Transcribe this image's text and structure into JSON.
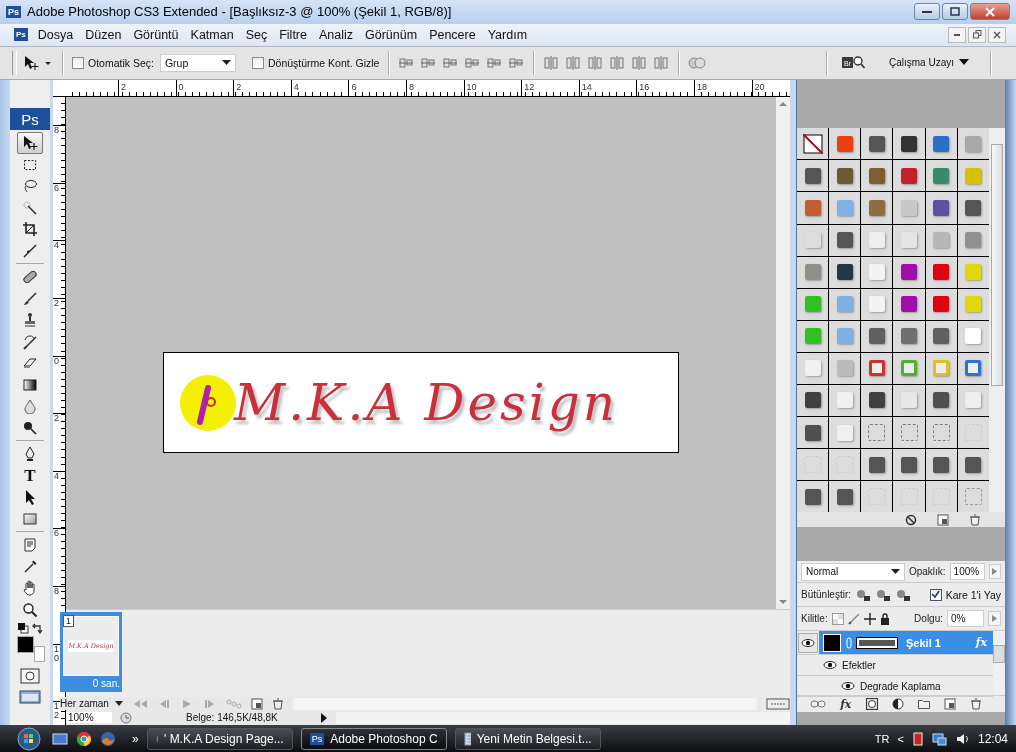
{
  "window": {
    "badge": "Ps",
    "title": "Adobe Photoshop CS3 Extended - [Başlıksız-3 @ 100% (Şekil 1, RGB/8)]"
  },
  "menu": {
    "badge": "Ps",
    "items": [
      "Dosya",
      "Düzen",
      "Görüntü",
      "Katman",
      "Seç",
      "Filtre",
      "Analiz",
      "Görünüm",
      "Pencere",
      "Yardım"
    ]
  },
  "options_bar": {
    "auto_select": {
      "label": "Otomatik Seç:",
      "checked": false
    },
    "auto_select_mode": "Grup",
    "transform_controls": {
      "label": "Dönüştürme Kont. Gizle",
      "checked": false
    },
    "bridge_badge": "Br",
    "workspace": "Çalışma Uzayı"
  },
  "toolbox": {
    "badge": "Ps",
    "tools": [
      {
        "kind": "move",
        "selected": true
      },
      {
        "kind": "marquee",
        "selected": false
      },
      {
        "kind": "lasso",
        "selected": false
      },
      {
        "kind": "wand",
        "selected": false
      },
      {
        "kind": "crop",
        "selected": false
      },
      {
        "kind": "slice",
        "selected": false
      },
      {
        "kind": "healing",
        "selected": false
      },
      {
        "kind": "brush",
        "selected": false
      },
      {
        "kind": "stamp",
        "selected": false
      },
      {
        "kind": "history",
        "selected": false
      },
      {
        "kind": "eraser",
        "selected": false
      },
      {
        "kind": "gradient",
        "selected": false
      },
      {
        "kind": "blur",
        "selected": false
      },
      {
        "kind": "dodge",
        "selected": false
      },
      {
        "kind": "pen",
        "selected": false
      },
      {
        "kind": "type",
        "label": "T",
        "selected": false
      },
      {
        "kind": "path",
        "selected": false
      },
      {
        "kind": "shape",
        "selected": false
      },
      {
        "kind": "notes",
        "selected": false
      },
      {
        "kind": "eyedropper",
        "selected": false
      },
      {
        "kind": "hand",
        "selected": false
      },
      {
        "kind": "zoom",
        "selected": false
      }
    ]
  },
  "rulers": {
    "horizontal": [
      "2",
      "0",
      "2",
      "4",
      "6",
      "8",
      "10",
      "12",
      "14",
      "16",
      "18",
      "20"
    ],
    "vertical": [
      "8",
      "6",
      "4",
      "2",
      "0",
      "2",
      "4",
      "6",
      "8",
      "10",
      "12"
    ]
  },
  "document": {
    "logo_text": "M.K.A Design"
  },
  "animation": {
    "frames": [
      {
        "number": "1",
        "thumbnail_text": "M.K.A Design",
        "delay": "0 san.",
        "selected": true
      }
    ],
    "loop": "Her zaman"
  },
  "status_bar": {
    "zoom": "100%",
    "doc_info": "Belge: 146,5K/48,8K"
  },
  "styles": [
    {
      "kind": "none",
      "color": "#ffffff"
    },
    {
      "kind": "fill",
      "color": "#e84010"
    },
    {
      "kind": "fill",
      "color": "#555555"
    },
    {
      "kind": "fill",
      "color": "#333333"
    },
    {
      "kind": "fill",
      "color": "#2a70c8"
    },
    {
      "kind": "fill",
      "color": "#a8a8a8"
    },
    {
      "kind": "fill",
      "color": "#555555"
    },
    {
      "kind": "fill",
      "color": "#6b5a3a"
    },
    {
      "kind": "fill",
      "color": "#7a6030"
    },
    {
      "kind": "fill",
      "color": "#c02030"
    },
    {
      "kind": "fill",
      "color": "#3a8a6a"
    },
    {
      "kind": "fill",
      "color": "#d8c000"
    },
    {
      "kind": "fill",
      "color": "#c06030"
    },
    {
      "kind": "fill",
      "color": "#80b0e8"
    },
    {
      "kind": "fill",
      "color": "#8a7040"
    },
    {
      "kind": "fill",
      "color": "#c8c8c8"
    },
    {
      "kind": "fill",
      "color": "#6050a0"
    },
    {
      "kind": "fill",
      "color": "#555555"
    },
    {
      "kind": "fill",
      "color": "#dddddd"
    },
    {
      "kind": "fill",
      "color": "#555555"
    },
    {
      "kind": "fill",
      "color": "#eeeeee"
    },
    {
      "kind": "fill",
      "color": "#e4e4e4"
    },
    {
      "kind": "fill",
      "color": "#b8b8b8"
    },
    {
      "kind": "fill",
      "color": "#909090"
    },
    {
      "kind": "fill",
      "color": "#909088"
    },
    {
      "kind": "fill",
      "color": "#203848"
    },
    {
      "kind": "fill",
      "color": "#f4f4f4"
    },
    {
      "kind": "fill",
      "color": "#a010a8"
    },
    {
      "kind": "fill",
      "color": "#e00010"
    },
    {
      "kind": "fill",
      "color": "#e0d800"
    },
    {
      "kind": "fill",
      "color": "#30c020"
    },
    {
      "kind": "fill",
      "color": "#80b0e0"
    },
    {
      "kind": "fill",
      "color": "#f4f4f4"
    },
    {
      "kind": "fill",
      "color": "#a010a8"
    },
    {
      "kind": "fill",
      "color": "#e00010"
    },
    {
      "kind": "fill",
      "color": "#e0d800"
    },
    {
      "kind": "fill",
      "color": "#30c020"
    },
    {
      "kind": "fill",
      "color": "#80b0e0"
    },
    {
      "kind": "fill",
      "color": "#606060"
    },
    {
      "kind": "fill",
      "color": "#707070"
    },
    {
      "kind": "fill",
      "color": "#606060"
    },
    {
      "kind": "fill",
      "color": "#ffffff"
    },
    {
      "kind": "fill",
      "color": "#f0f0f0"
    },
    {
      "kind": "fill",
      "color": "#bbbbbb"
    },
    {
      "kind": "frame",
      "color": "#d03030"
    },
    {
      "kind": "frame",
      "color": "#50b030"
    },
    {
      "kind": "frame",
      "color": "#e0c020"
    },
    {
      "kind": "frame",
      "color": "#3070d0"
    },
    {
      "kind": "fill",
      "color": "#404040"
    },
    {
      "kind": "fill",
      "color": "#f0f0f0"
    },
    {
      "kind": "fill",
      "color": "#404040"
    },
    {
      "kind": "fill",
      "color": "#e8e8e8"
    },
    {
      "kind": "fill",
      "color": "#505050"
    },
    {
      "kind": "fill",
      "color": "#eeeeee"
    },
    {
      "kind": "fill",
      "color": "#505050"
    },
    {
      "kind": "fill",
      "color": "#f0f0f0"
    },
    {
      "kind": "dashed",
      "color": "#808080"
    },
    {
      "kind": "dashed",
      "color": "#808080"
    },
    {
      "kind": "dashed",
      "color": "#808080"
    },
    {
      "kind": "dashed",
      "color": "#cccccc"
    },
    {
      "kind": "dashed",
      "color": "#cccccc"
    },
    {
      "kind": "dashed",
      "color": "#cccccc"
    },
    {
      "kind": "fill",
      "color": "#555555"
    },
    {
      "kind": "fill",
      "color": "#555555"
    },
    {
      "kind": "fill",
      "color": "#555555"
    },
    {
      "kind": "fill",
      "color": "#555555"
    },
    {
      "kind": "fill",
      "color": "#555555"
    },
    {
      "kind": "fill",
      "color": "#555555"
    },
    {
      "kind": "dashed",
      "color": "#cccccc"
    },
    {
      "kind": "dashed",
      "color": "#cccccc"
    },
    {
      "kind": "dashed",
      "color": "#cccccc"
    },
    {
      "kind": "dashed",
      "color": "#999999"
    }
  ],
  "layers_panel": {
    "blend_mode": "Normal",
    "opacity_label": "Opaklık:",
    "opacity": "100%",
    "unify_label": "Bütünleştir:",
    "propagate": {
      "label": "Kare 1'i Yay",
      "checked": true
    },
    "lock_label": "Kilitle:",
    "fill_label": "Dolgu:",
    "fill": "0%",
    "footer_fx": "fx",
    "layers": [
      {
        "name": "Şekil 1",
        "fx": "fx",
        "selected": true,
        "visible": true,
        "children": [
          {
            "name": "Efektler",
            "selected": false,
            "visible": true,
            "children": [
              {
                "name": "Degrade Kaplama",
                "selected": false,
                "visible": true
              }
            ]
          }
        ]
      }
    ]
  },
  "taskbar": {
    "overflow": "»",
    "tasks": [
      {
        "kind": "browser",
        "label": "' M.K.A Design Page...",
        "selected": false
      },
      {
        "kind": "photoshop",
        "badge": "Ps",
        "label": "Adobe Photoshop C",
        "selected": true
      },
      {
        "kind": "notepad",
        "label": "Yeni Metin Belgesi.t...",
        "selected": false
      }
    ],
    "language": "TR",
    "tray_toggle": "<",
    "clock": "12:04"
  }
}
